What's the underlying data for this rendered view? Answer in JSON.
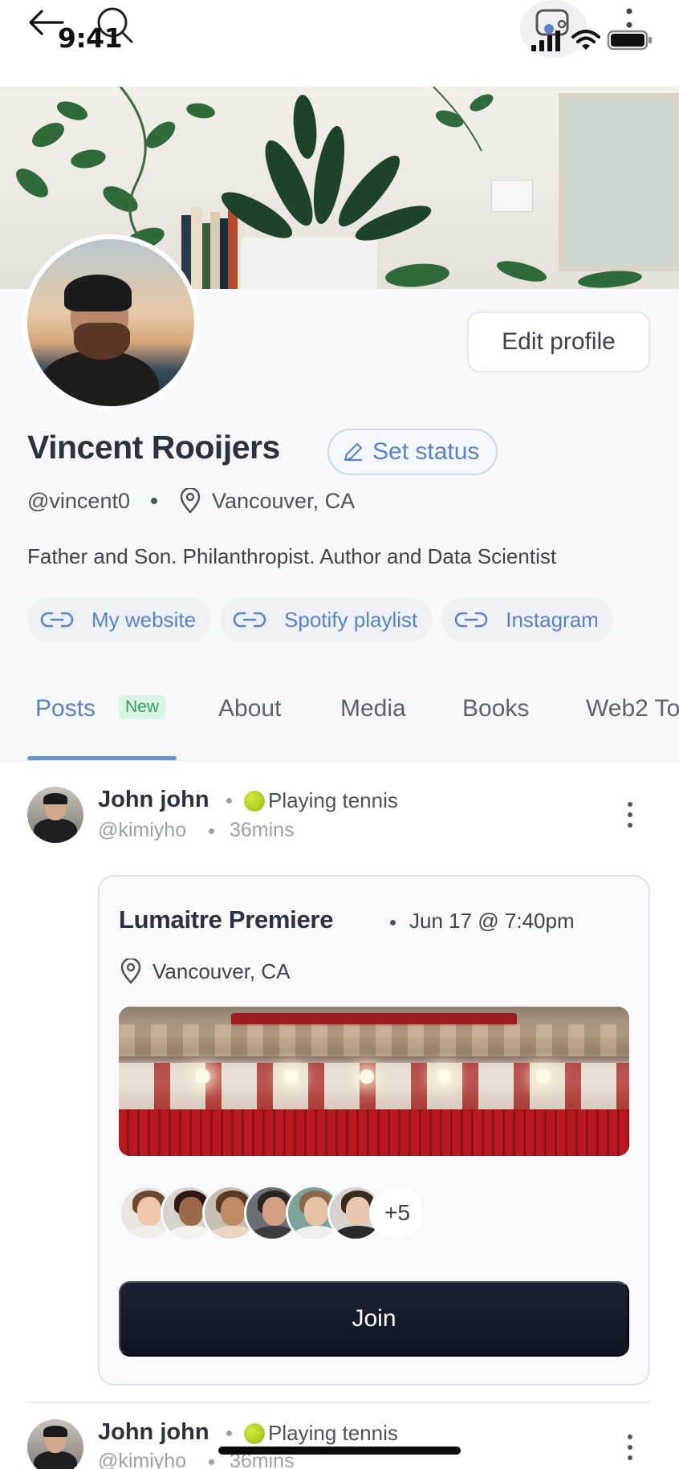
{
  "status_bar": {
    "time": "9:41"
  },
  "profile": {
    "name": "Vincent Rooijers",
    "set_status_label": "Set status",
    "edit_profile_label": "Edit profile",
    "handle": "@vincent0",
    "location": "Vancouver, CA",
    "bio": "Father and Son. Philanthropist. Author and Data Scientist",
    "links": [
      {
        "label": "My website"
      },
      {
        "label": "Spotify playlist"
      },
      {
        "label": "Instagram"
      }
    ]
  },
  "tabs": {
    "items": [
      {
        "label": "Posts",
        "active": true
      },
      {
        "label": "About"
      },
      {
        "label": "Media"
      },
      {
        "label": "Books"
      },
      {
        "label": "Web2 To"
      }
    ],
    "new_badge": "New"
  },
  "posts": [
    {
      "author": "John john",
      "activity": "Playing tennis",
      "handle": "@kimiyho",
      "time": "36mins",
      "event": {
        "title": "Lumaitre Premiere",
        "date": "Jun 17 @ 7:40pm",
        "location": "Vancouver, CA",
        "more_attendees": "+5",
        "join_label": "Join"
      }
    },
    {
      "author": "John john",
      "activity": "Playing tennis",
      "handle": "@kimiyho",
      "time": "36mins"
    }
  ],
  "colors": {
    "accent": "#5b82c6",
    "join_button": "#131a2b",
    "badge_bg": "#daf5e3",
    "badge_text": "#2f9e5b"
  },
  "icons": [
    "back-arrow-icon",
    "search-icon",
    "chat-icon",
    "more-vertical-icon",
    "pencil-icon",
    "location-pin-icon",
    "link-icon",
    "tennis-ball-icon"
  ]
}
